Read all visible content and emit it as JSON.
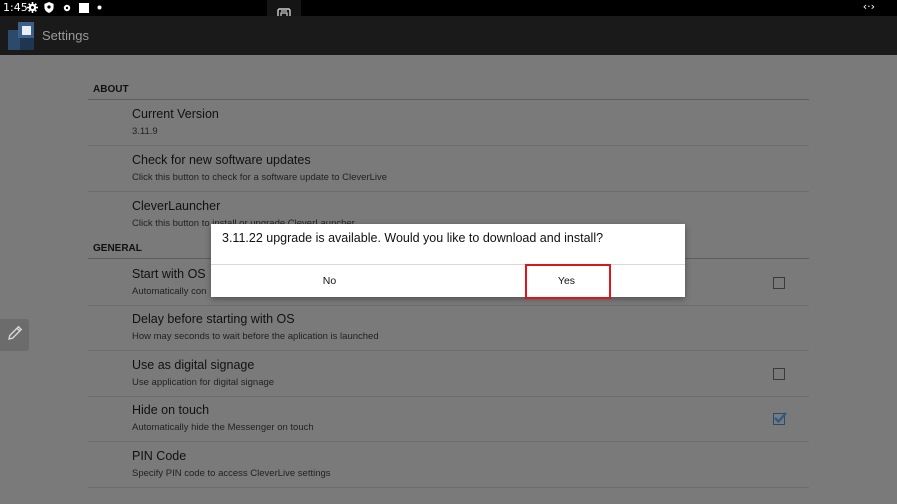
{
  "status_bar": {
    "time": "1:45",
    "icons": [
      "gear-icon",
      "shield-icon",
      "small-gear-icon",
      "square-icon",
      "dot-icon"
    ],
    "right_icon": "‹·›"
  },
  "action_bar": {
    "title": "Settings"
  },
  "sections": {
    "about": {
      "header": "ABOUT",
      "items": [
        {
          "title": "Current Version",
          "summary": "3.11.9"
        },
        {
          "title": "Check for new software updates",
          "summary": "Click this button to check for a software update to CleverLive"
        },
        {
          "title": "CleverLauncher",
          "summary": "Click this button to install or upgrade CleverLauncher"
        }
      ]
    },
    "general": {
      "header": "GENERAL",
      "items": [
        {
          "title": "Start with OS",
          "summary": "Automatically con",
          "checkbox": false
        },
        {
          "title": "Delay before starting with OS",
          "summary": "How may seconds to wait before the aplication is launched"
        },
        {
          "title": "Use as digital signage",
          "summary": "Use application for digital signage",
          "checkbox": false
        },
        {
          "title": "Hide on touch",
          "summary": "Automatically hide the Messenger on touch",
          "checkbox": true
        },
        {
          "title": "PIN Code",
          "summary": "Specify PIN code to access CleverLive settings"
        }
      ]
    }
  },
  "dialog": {
    "message": "3.11.22 upgrade is available. Would you like to download and install?",
    "no_label": "No",
    "yes_label": "Yes"
  },
  "colors": {
    "highlight": "#e0151b",
    "checkbox_check": "#2a5b8c"
  }
}
